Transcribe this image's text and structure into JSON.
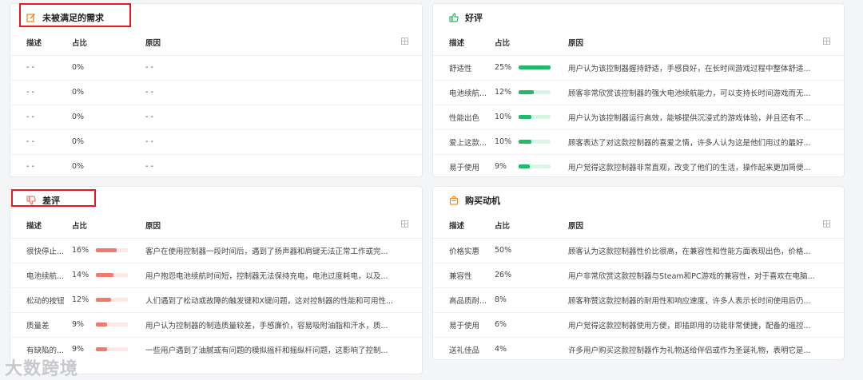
{
  "colors": {
    "good": "#1fba6a",
    "good_track": "#d9f5e6",
    "bad": "#ef7a6f",
    "bad_track": "#fde8e6",
    "highlight": "#e8191f",
    "accent": "#f08a24"
  },
  "unmet": {
    "title": "未被满足的需求",
    "icon": "edit-icon",
    "columns": [
      "描述",
      "占比",
      "原因"
    ],
    "rows": [
      {
        "desc": "- -",
        "pct": "0%",
        "reason": "- -"
      },
      {
        "desc": "- -",
        "pct": "0%",
        "reason": "- -"
      },
      {
        "desc": "- -",
        "pct": "0%",
        "reason": "- -"
      },
      {
        "desc": "- -",
        "pct": "0%",
        "reason": "- -"
      },
      {
        "desc": "- -",
        "pct": "0%",
        "reason": "- -"
      }
    ]
  },
  "good": {
    "title": "好评",
    "icon": "thumbs-up-icon",
    "columns": [
      "描述",
      "占比",
      "原因"
    ],
    "rows": [
      {
        "desc": "舒适性",
        "pct": "25%",
        "value": 25,
        "reason": "用户认为该控制器握持舒适，手感良好，在长时间游戏过程中整体舒适..."
      },
      {
        "desc": "电池续航...",
        "pct": "12%",
        "value": 12,
        "reason": "顾客非常欣赏该控制器的强大电池续航能力，可以支持长时间游戏而无..."
      },
      {
        "desc": "性能出色",
        "pct": "10%",
        "value": 10,
        "reason": "用户认为该控制器运行高效，能够提供沉浸式的游戏体验，并且还有不..."
      },
      {
        "desc": "爱上这款...",
        "pct": "10%",
        "value": 10,
        "reason": "顾客表达了对这款控制器的喜爱之情，许多人认为这是他们用过的最好..."
      },
      {
        "desc": "易于使用",
        "pct": "9%",
        "value": 9,
        "reason": "用户觉得这款控制器非常直观，改变了他们的生活，操作起来更加简便..."
      }
    ]
  },
  "bad": {
    "title": "差评",
    "icon": "thumbs-down-icon",
    "columns": [
      "描述",
      "占比",
      "原因"
    ],
    "rows": [
      {
        "desc": "很快停止...",
        "pct": "16%",
        "value": 16,
        "reason": "客户在使用控制器一段时间后，遇到了扬声器和肩键无法正常工作或完..."
      },
      {
        "desc": "电池续航...",
        "pct": "14%",
        "value": 14,
        "reason": "用户抱怨电池续航时间短，控制器无法保持充电，电池过度耗电，以及..."
      },
      {
        "desc": "松动的按钮",
        "pct": "12%",
        "value": 12,
        "reason": "人们遇到了松动或故障的触发键和X键问题，这对控制器的性能和可用性..."
      },
      {
        "desc": "质量差",
        "pct": "9%",
        "value": 9,
        "reason": "用户认为控制器的制造质量较差，手感廉价，容易吸附油脂和汗水，质..."
      },
      {
        "desc": "有缺陷的...",
        "pct": "9%",
        "value": 9,
        "reason": "一些用户遇到了油腻或有问题的模拟摇杆和摇纵杆问题，这影响了控制..."
      }
    ]
  },
  "motive": {
    "title": "购买动机",
    "icon": "shopping-bag-icon",
    "columns": [
      "描述",
      "占比",
      "原因"
    ],
    "rows": [
      {
        "desc": "价格实惠",
        "pct": "50%",
        "reason": "顾客认为这款控制器性价比很高，在兼容性和性能方面表现出色，价格..."
      },
      {
        "desc": "兼容性",
        "pct": "26%",
        "reason": "用户非常欣赏这款控制器与Steam和PC游戏的兼容性，对于喜欢在电脑..."
      },
      {
        "desc": "高品质耐...",
        "pct": "8%",
        "reason": "顾客称赞这款控制器的耐用性和响应速度，许多人表示长时间使用后仍..."
      },
      {
        "desc": "易于使用",
        "pct": "6%",
        "reason": "用户觉得这款控制器使用方便，即插即用的功能非常便捷，配备的遥控..."
      },
      {
        "desc": "送礼佳品",
        "pct": "4%",
        "reason": "许多用户购买这款控制器作为礼物送给伴侣或作为圣诞礼物，表明它是..."
      }
    ]
  },
  "watermark": "大数跨境"
}
